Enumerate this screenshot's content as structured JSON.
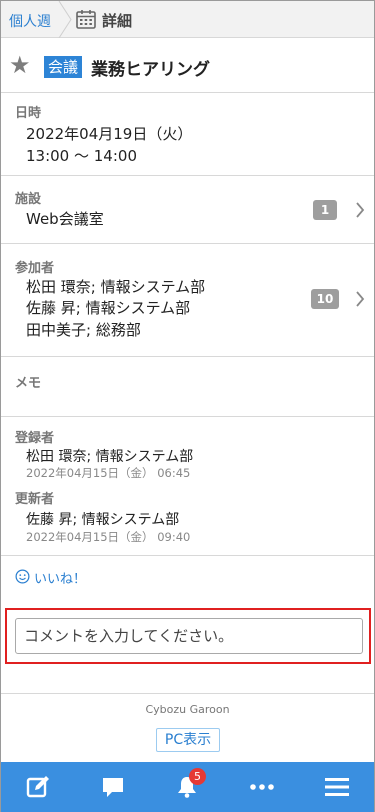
{
  "breadcrumb": {
    "first": "個人週",
    "current": "詳細"
  },
  "event": {
    "category": "会議",
    "title": "業務ヒアリング"
  },
  "datetime": {
    "label": "日時",
    "date": "2022年04月19日（火）",
    "time": "13:00 〜 14:00"
  },
  "facility": {
    "label": "施設",
    "value": "Web会議室",
    "count": "1"
  },
  "attendees": {
    "label": "参加者",
    "items": [
      "松田 環奈; 情報システム部",
      "佐藤 昇; 情報システム部",
      "田中美子; 総務部"
    ],
    "count": "10"
  },
  "memo": {
    "label": "メモ"
  },
  "registrant": {
    "label": "登録者",
    "name": "松田 環奈; 情報システム部",
    "timestamp": "2022年04月15日（金） 06:45"
  },
  "updater": {
    "label": "更新者",
    "name": "佐藤 昇; 情報システム部",
    "timestamp": "2022年04月15日（金） 09:40"
  },
  "like": {
    "label": "いいね！"
  },
  "comment": {
    "placeholder": "コメントを入力してください。"
  },
  "footer": {
    "brand": "Cybozu Garoon",
    "pc_view": "PC表示"
  },
  "bottom_nav": {
    "notification_count": "5"
  },
  "colors": {
    "accent": "#2d84d6",
    "nav_bar": "#3a8fe0",
    "highlight_border": "#e02020",
    "badge_red": "#e53935"
  }
}
